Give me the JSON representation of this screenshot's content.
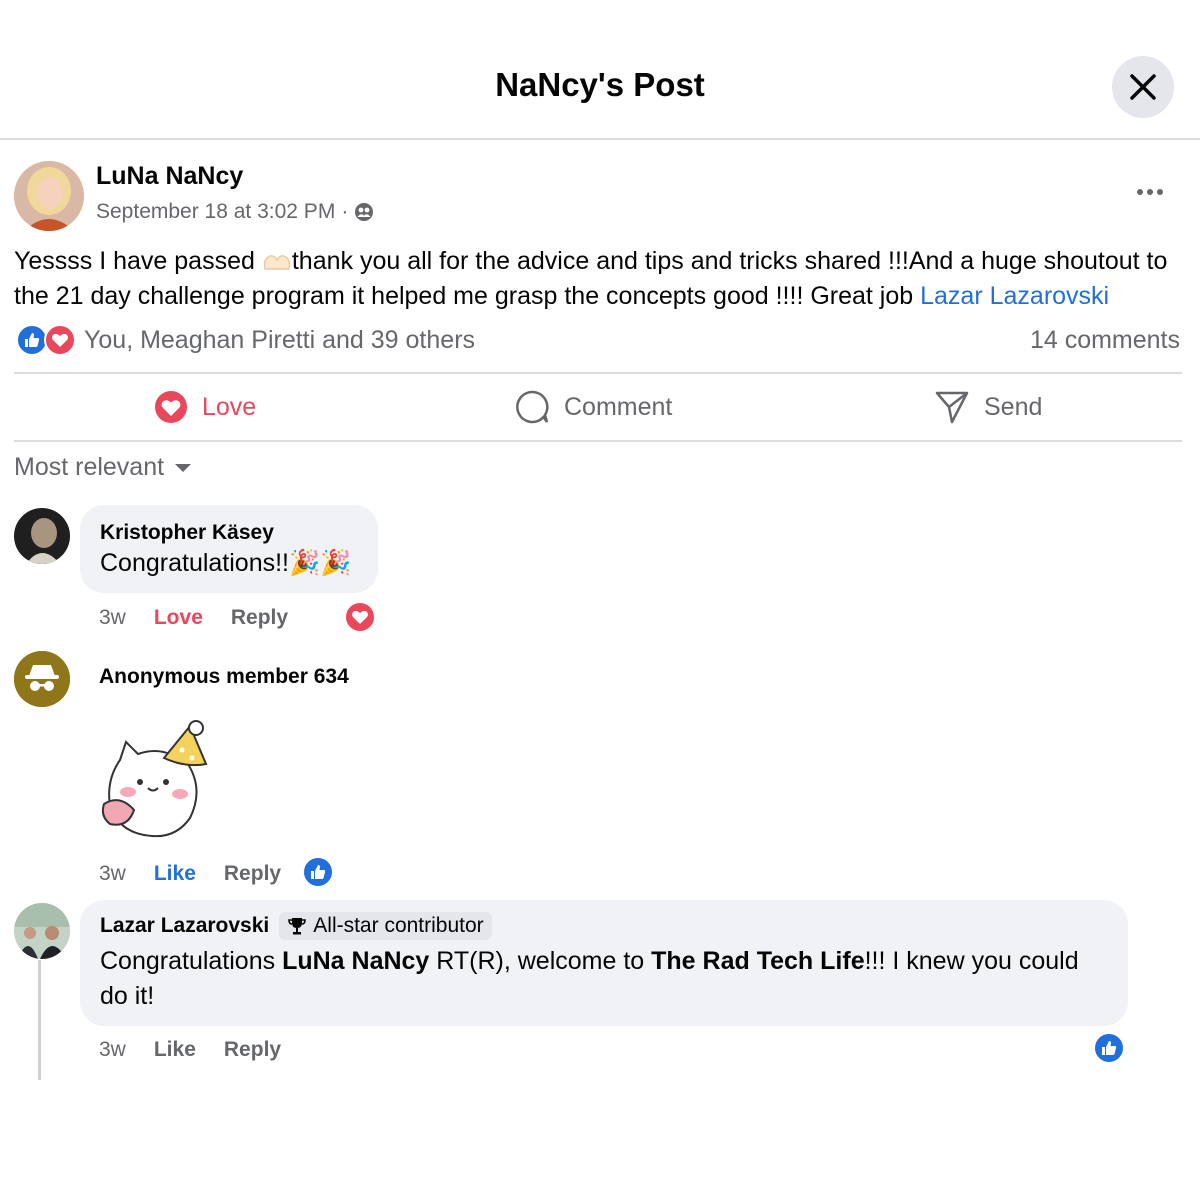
{
  "header": {
    "title": "NaNcy's Post",
    "close_icon": "close-icon"
  },
  "post": {
    "author": "LuNa NaNcy",
    "timestamp": "September 18 at 3:02 PM",
    "separator": "·",
    "audience_icon": "group-icon",
    "text_part1": "Yessss I have passed ",
    "emoji": "heart-hands-emoji",
    "text_part2": "thank you all for the advice and tips and tricks shared !!!And a huge shoutout to the 21 day challenge program it helped me grasp the concepts good !!!! Great job ",
    "mention": "Lazar Lazarovski",
    "reactions_text": "You, Meaghan Piretti and 39 others",
    "comments_count": "14 comments"
  },
  "actions": {
    "love": "Love",
    "comment": "Comment",
    "send": "Send"
  },
  "sort": {
    "label": "Most relevant"
  },
  "comments": [
    {
      "name": "Kristopher Käsey",
      "text": "Congratulations!!🎉🎉",
      "time": "3w",
      "react_label": "Love",
      "reply_label": "Reply",
      "reaction": "love"
    },
    {
      "name": "Anonymous member 634",
      "sticker": "party-cat-sticker",
      "time": "3w",
      "react_label": "Like",
      "reply_label": "Reply",
      "reaction": "like"
    },
    {
      "name": "Lazar Lazarovski",
      "badge": "All-star contributor",
      "text_part1": "Congratulations ",
      "bold1": "LuNa NaNcy",
      "text_part2": " RT(R), welcome to ",
      "bold2": "The Rad Tech Life",
      "text_part3": "!!! I knew you could do it!",
      "time": "3w",
      "react_label": "Like",
      "reply_label": "Reply",
      "reaction": "like"
    }
  ],
  "colors": {
    "love": "#e9475b",
    "like": "#216fdb",
    "muted": "#65676b",
    "bubble": "#f0f2f5"
  }
}
